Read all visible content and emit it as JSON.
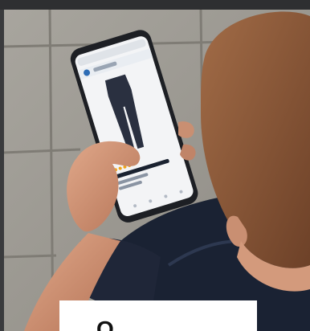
{
  "photo": {
    "subject": "phone-shopping-photo",
    "caption_card": {
      "visible_text": "O"
    }
  },
  "phone": {
    "product_title": "",
    "rating_stars": 5
  },
  "colors": {
    "pavement": "#9c9a93",
    "jacket": "#1a2233",
    "skin": "#c98f72",
    "hair": "#8b5a3c",
    "phone_body": "#1d1f24",
    "screen": "#f3f4f6",
    "leggings": "#2a3040"
  }
}
